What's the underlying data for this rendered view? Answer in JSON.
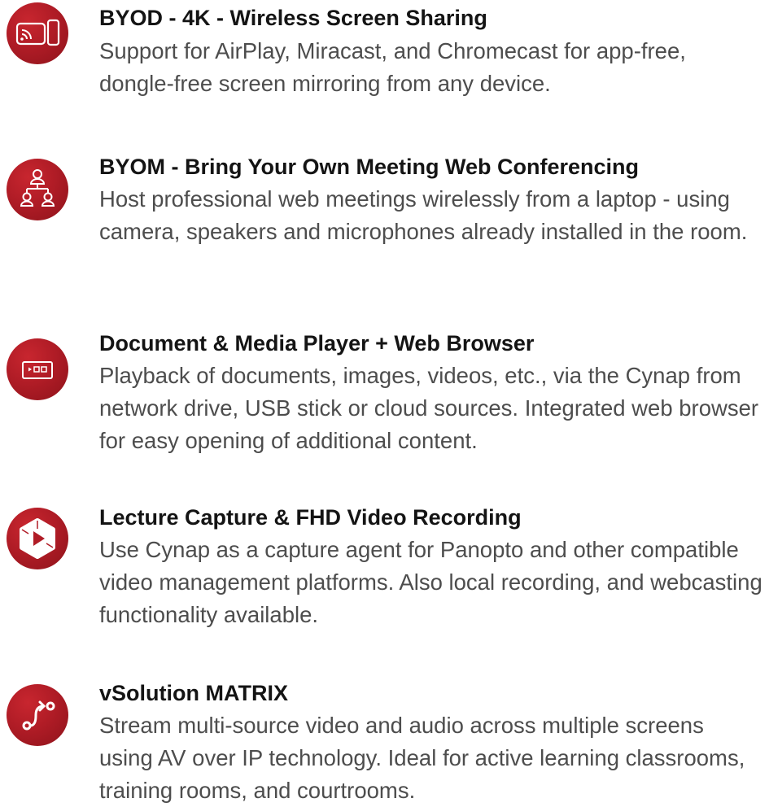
{
  "features": [
    {
      "icon": "screen-mirroring-icon",
      "title": "BYOD - 4K - Wireless Screen Sharing",
      "description": "Support for AirPlay, Miracast, and Chromecast for app-free, dongle-free screen mirroring from any device."
    },
    {
      "icon": "meeting-hierarchy-icon",
      "title": "BYOM - Bring Your Own Meeting Web Conferencing",
      "description": "Host professional web meetings wirelessly from a laptop - using camera, speakers and microphones already installed in the room."
    },
    {
      "icon": "media-player-icon",
      "title": "Document & Media Player + Web Browser",
      "description": "Playback of documents, images, videos, etc., via the Cynap from network drive, USB stick or cloud sources. Integrated web browser for easy opening of additional content."
    },
    {
      "icon": "lecture-capture-icon",
      "title": "Lecture Capture & FHD Video Recording",
      "description": "Use Cynap as a capture agent for Panopto and other compatible video management platforms. Also local recording, and webcasting functionality available."
    },
    {
      "icon": "route-matrix-icon",
      "title": "vSolution MATRIX",
      "description": "Stream multi-source video and audio across multiple screens using AV over IP technology. Ideal for active learning classrooms, training rooms, and courtrooms."
    }
  ],
  "colors": {
    "icon_red": "#b01c26",
    "title": "#141414",
    "text": "#4d4d4d"
  }
}
